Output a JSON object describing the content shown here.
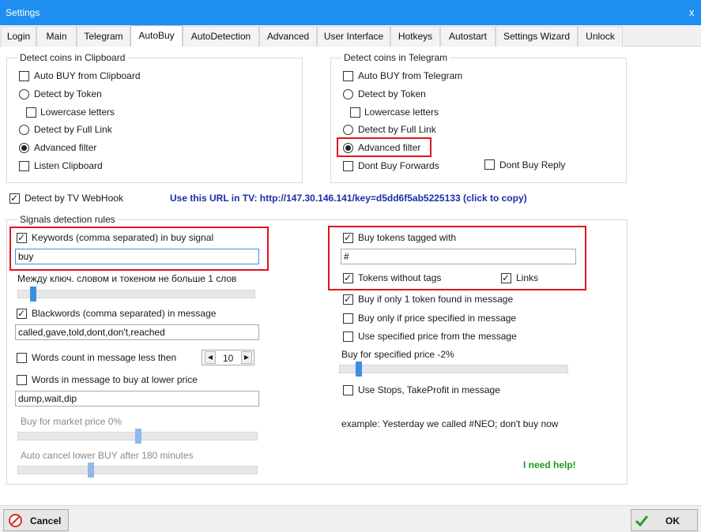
{
  "window": {
    "title": "Settings",
    "close_glyph": "x"
  },
  "tabs": [
    {
      "label": "Login"
    },
    {
      "label": "Main"
    },
    {
      "label": "Telegram"
    },
    {
      "label": "AutoBuy",
      "active": true
    },
    {
      "label": "AutoDetection"
    },
    {
      "label": "Advanced"
    },
    {
      "label": "User Interface"
    },
    {
      "label": "Hotkeys"
    },
    {
      "label": "Autostart"
    },
    {
      "label": "Settings Wizard"
    },
    {
      "label": "Unlock"
    }
  ],
  "clipboard_group": {
    "legend": "Detect coins in Clipboard",
    "auto_buy": {
      "label": "Auto BUY from Clipboard",
      "checked": false
    },
    "detect_token": {
      "label": "Detect by Token",
      "checked": false
    },
    "lowercase": {
      "label": "Lowercase letters",
      "checked": false
    },
    "detect_full_link": {
      "label": "Detect by Full Link",
      "checked": false
    },
    "advanced_filter": {
      "label": "Advanced filter",
      "checked": true
    },
    "listen_clipboard": {
      "label": "Listen Clipboard",
      "checked": false
    }
  },
  "telegram_group": {
    "legend": "Detect coins in Telegram",
    "auto_buy": {
      "label": "Auto BUY from Telegram",
      "checked": false
    },
    "detect_token": {
      "label": "Detect by Token",
      "checked": false
    },
    "lowercase": {
      "label": "Lowercase letters",
      "checked": false
    },
    "detect_full_link": {
      "label": "Detect by Full Link",
      "checked": false
    },
    "advanced_filter": {
      "label": "Advanced filter",
      "checked": true
    },
    "dont_buy_forwards": {
      "label": "Dont Buy Forwards",
      "checked": false
    },
    "dont_buy_reply": {
      "label": "Dont Buy Reply",
      "checked": false
    }
  },
  "webhook": {
    "label": "Detect by TV WebHook",
    "checked": true,
    "url_text": "Use this URL in TV: http://147.30.146.141/key=d5dd6f5ab5225133 (click to copy)"
  },
  "signals": {
    "legend": "Signals detection rules",
    "keywords": {
      "label": "Keywords (comma separated) in buy signal",
      "checked": true,
      "value": "buy"
    },
    "distance_label": "Между ключ. словом и токеном не больше 1 слов",
    "distance_level": 1,
    "blackwords": {
      "label": "Blackwords (comma separated) in message",
      "checked": true,
      "value": "called,gave,told,dont,don't,reached"
    },
    "words_count": {
      "label": "Words count in message less then",
      "checked": false,
      "value": "10",
      "left_arrow": "◀",
      "right_arrow": "▶"
    },
    "lower_price": {
      "label": "Words in message to buy at lower price",
      "checked": false,
      "value": "dump,wait,dip"
    },
    "market_price": {
      "label": "Buy for market price 0%",
      "percent": 0
    },
    "auto_cancel": {
      "label": "Auto cancel lower BUY after 180 minutes",
      "minutes": 180
    },
    "tagged": {
      "label": "Buy tokens tagged with",
      "checked": true,
      "value": "#"
    },
    "without_tags": {
      "label": "Tokens without tags",
      "checked": true
    },
    "links": {
      "label": "Links",
      "checked": true
    },
    "only_one": {
      "label": "Buy if only 1 token found in message",
      "checked": true
    },
    "price_specified": {
      "label": "Buy only if price specified in message",
      "checked": false
    },
    "use_specified": {
      "label": "Use specified price from the message",
      "checked": false
    },
    "specified_price": {
      "label": "Buy for specified price -2%",
      "percent": -2
    },
    "stops": {
      "label": "Use Stops, TakeProfit in message",
      "checked": false
    },
    "example": "example: Yesterday we called #NEO; don't buy now",
    "help": "I need help!"
  },
  "footer": {
    "cancel_label": "Cancel",
    "ok_label": "OK",
    "colors": {
      "cancel_icon": "#d93025",
      "ok_icon": "#2e9b2e"
    }
  }
}
